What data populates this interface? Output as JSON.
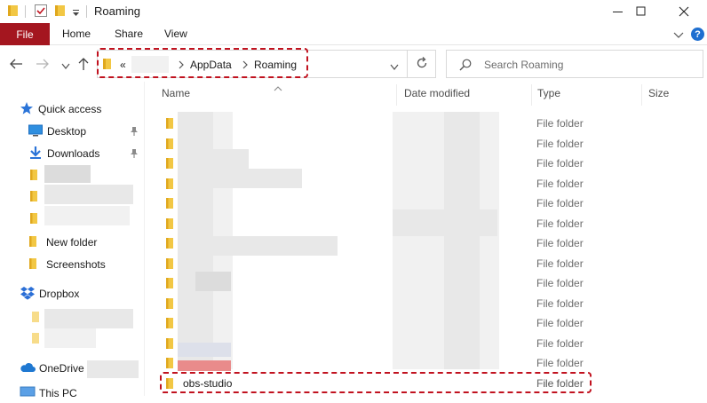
{
  "window": {
    "title": "Roaming",
    "minimize": "minimize",
    "maximize": "maximize",
    "close": "close"
  },
  "ribbon": {
    "file": "File",
    "home": "Home",
    "share": "Share",
    "view": "View",
    "help": "?"
  },
  "address": {
    "overflow": "«",
    "crumbs": [
      "AppData",
      "Roaming"
    ]
  },
  "search": {
    "placeholder": "Search Roaming"
  },
  "columns": {
    "name": "Name",
    "date": "Date modified",
    "type": "Type",
    "size": "Size"
  },
  "sidebar": {
    "quick_access": "Quick access",
    "desktop": "Desktop",
    "downloads": "Downloads",
    "new_folder": "New folder",
    "screenshots": "Screenshots",
    "dropbox": "Dropbox",
    "onedrive": "OneDrive",
    "this_pc": "This PC"
  },
  "rows": [
    {
      "type": "File folder"
    },
    {
      "type": "File folder"
    },
    {
      "type": "File folder"
    },
    {
      "type": "File folder"
    },
    {
      "type": "File folder"
    },
    {
      "type": "File folder"
    },
    {
      "type": "File folder"
    },
    {
      "type": "File folder"
    },
    {
      "type": "File folder"
    },
    {
      "type": "File folder"
    },
    {
      "type": "File folder"
    },
    {
      "type": "File folder"
    },
    {
      "type": "File folder"
    },
    {
      "type": "File folder"
    }
  ],
  "highlight_row": {
    "name": "obs-studio",
    "type": "File folder"
  },
  "colors": {
    "file_tab": "#a4161f",
    "highlight_dash": "#c1121f",
    "folder": "#f2c744",
    "accent_blue": "#1f6fd0"
  }
}
